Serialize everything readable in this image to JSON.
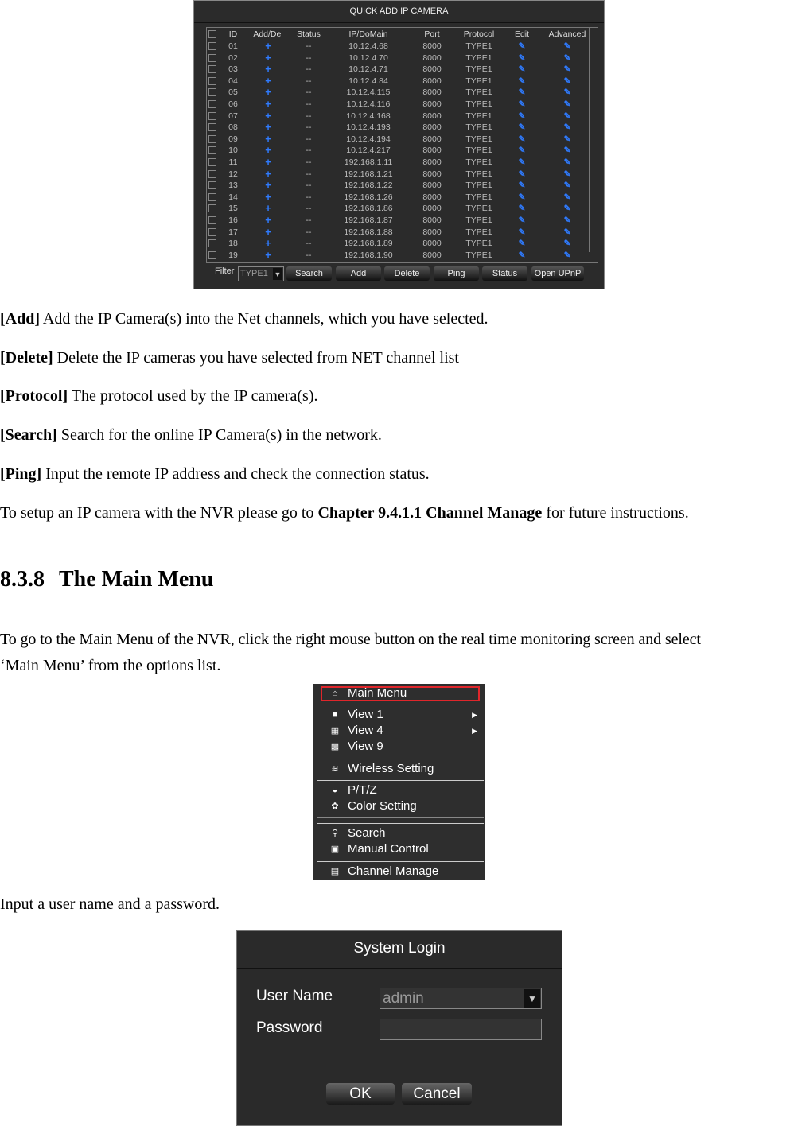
{
  "camera_dialog": {
    "title": "QUICK ADD IP CAMERA",
    "columns": [
      "ID",
      "Add/Del",
      "Status",
      "IP/DoMain",
      "Port",
      "Protocol",
      "Edit",
      "Advanced"
    ],
    "rows": [
      {
        "id": "01",
        "status": "--",
        "ip": "10.12.4.68",
        "port": "8000",
        "protocol": "TYPE1"
      },
      {
        "id": "02",
        "status": "--",
        "ip": "10.12.4.70",
        "port": "8000",
        "protocol": "TYPE1"
      },
      {
        "id": "03",
        "status": "--",
        "ip": "10.12.4.71",
        "port": "8000",
        "protocol": "TYPE1"
      },
      {
        "id": "04",
        "status": "--",
        "ip": "10.12.4.84",
        "port": "8000",
        "protocol": "TYPE1"
      },
      {
        "id": "05",
        "status": "--",
        "ip": "10.12.4.115",
        "port": "8000",
        "protocol": "TYPE1"
      },
      {
        "id": "06",
        "status": "--",
        "ip": "10.12.4.116",
        "port": "8000",
        "protocol": "TYPE1"
      },
      {
        "id": "07",
        "status": "--",
        "ip": "10.12.4.168",
        "port": "8000",
        "protocol": "TYPE1"
      },
      {
        "id": "08",
        "status": "--",
        "ip": "10.12.4.193",
        "port": "8000",
        "protocol": "TYPE1"
      },
      {
        "id": "09",
        "status": "--",
        "ip": "10.12.4.194",
        "port": "8000",
        "protocol": "TYPE1"
      },
      {
        "id": "10",
        "status": "--",
        "ip": "10.12.4.217",
        "port": "8000",
        "protocol": "TYPE1"
      },
      {
        "id": "11",
        "status": "--",
        "ip": "192.168.1.11",
        "port": "8000",
        "protocol": "TYPE1"
      },
      {
        "id": "12",
        "status": "--",
        "ip": "192.168.1.21",
        "port": "8000",
        "protocol": "TYPE1"
      },
      {
        "id": "13",
        "status": "--",
        "ip": "192.168.1.22",
        "port": "8000",
        "protocol": "TYPE1"
      },
      {
        "id": "14",
        "status": "--",
        "ip": "192.168.1.26",
        "port": "8000",
        "protocol": "TYPE1"
      },
      {
        "id": "15",
        "status": "--",
        "ip": "192.168.1.86",
        "port": "8000",
        "protocol": "TYPE1"
      },
      {
        "id": "16",
        "status": "--",
        "ip": "192.168.1.87",
        "port": "8000",
        "protocol": "TYPE1"
      },
      {
        "id": "17",
        "status": "--",
        "ip": "192.168.1.88",
        "port": "8000",
        "protocol": "TYPE1"
      },
      {
        "id": "18",
        "status": "--",
        "ip": "192.168.1.89",
        "port": "8000",
        "protocol": "TYPE1"
      },
      {
        "id": "19",
        "status": "--",
        "ip": "192.168.1.90",
        "port": "8000",
        "protocol": "TYPE1"
      }
    ],
    "filter_label": "Filter",
    "filter_value": "TYPE1",
    "buttons": [
      "Search",
      "Add",
      "Delete",
      "Ping",
      "Status",
      "Open UPnP"
    ],
    "accent": "#2f7bff"
  },
  "doc": {
    "items": [
      {
        "term": "[Add]",
        "text": " Add the IP Camera(s) into the Net channels, which you have selected."
      },
      {
        "term": "[Delete]",
        "text": " Delete the IP cameras you have selected from NET channel list"
      },
      {
        "term": "[Protocol]",
        "text": " The protocol used by the IP camera(s)."
      },
      {
        "term": "[Search]",
        "text": " Search for the online IP Camera(s) in the network."
      },
      {
        "term": "[Ping]",
        "text": " Input the remote IP address and check the connection status."
      }
    ],
    "setup_pre": "To setup an IP camera with the NVR please go to ",
    "setup_bold": "Chapter 9.4.1.1 Channel Manage",
    "setup_post": " for future instructions.",
    "heading_num": "8.3.8",
    "heading": "The Main Menu",
    "para1": "To go to the Main Menu of the NVR, click the right mouse button on the real time monitoring screen and select",
    "para2": "‘Main Menu’ from the options list.",
    "para3": "Input a user name and a password."
  },
  "context_menu": {
    "items": [
      {
        "label": "Main Menu",
        "icon": "home-icon"
      },
      {
        "label": "View 1",
        "icon": "view1-icon"
      },
      {
        "label": "View 4",
        "icon": "view4-icon"
      },
      {
        "label": "View 9",
        "icon": "view9-icon"
      },
      {
        "label": "Wireless Setting",
        "icon": "wifi-icon"
      },
      {
        "label": "P/T/Z",
        "icon": "dome-camera-icon"
      },
      {
        "label": "Color Setting",
        "icon": "palette-icon"
      },
      {
        "label": "Search",
        "icon": "search-icon"
      },
      {
        "label": "Manual Control",
        "icon": "monitor-icon"
      },
      {
        "label": "Channel Manage",
        "icon": "channel-icon"
      }
    ],
    "highlight_color": "#e0262b"
  },
  "login": {
    "title": "System Login",
    "user_label": "User Name",
    "user_value": "admin",
    "password_label": "Password",
    "password_value": "",
    "ok": "OK",
    "cancel": "Cancel"
  }
}
